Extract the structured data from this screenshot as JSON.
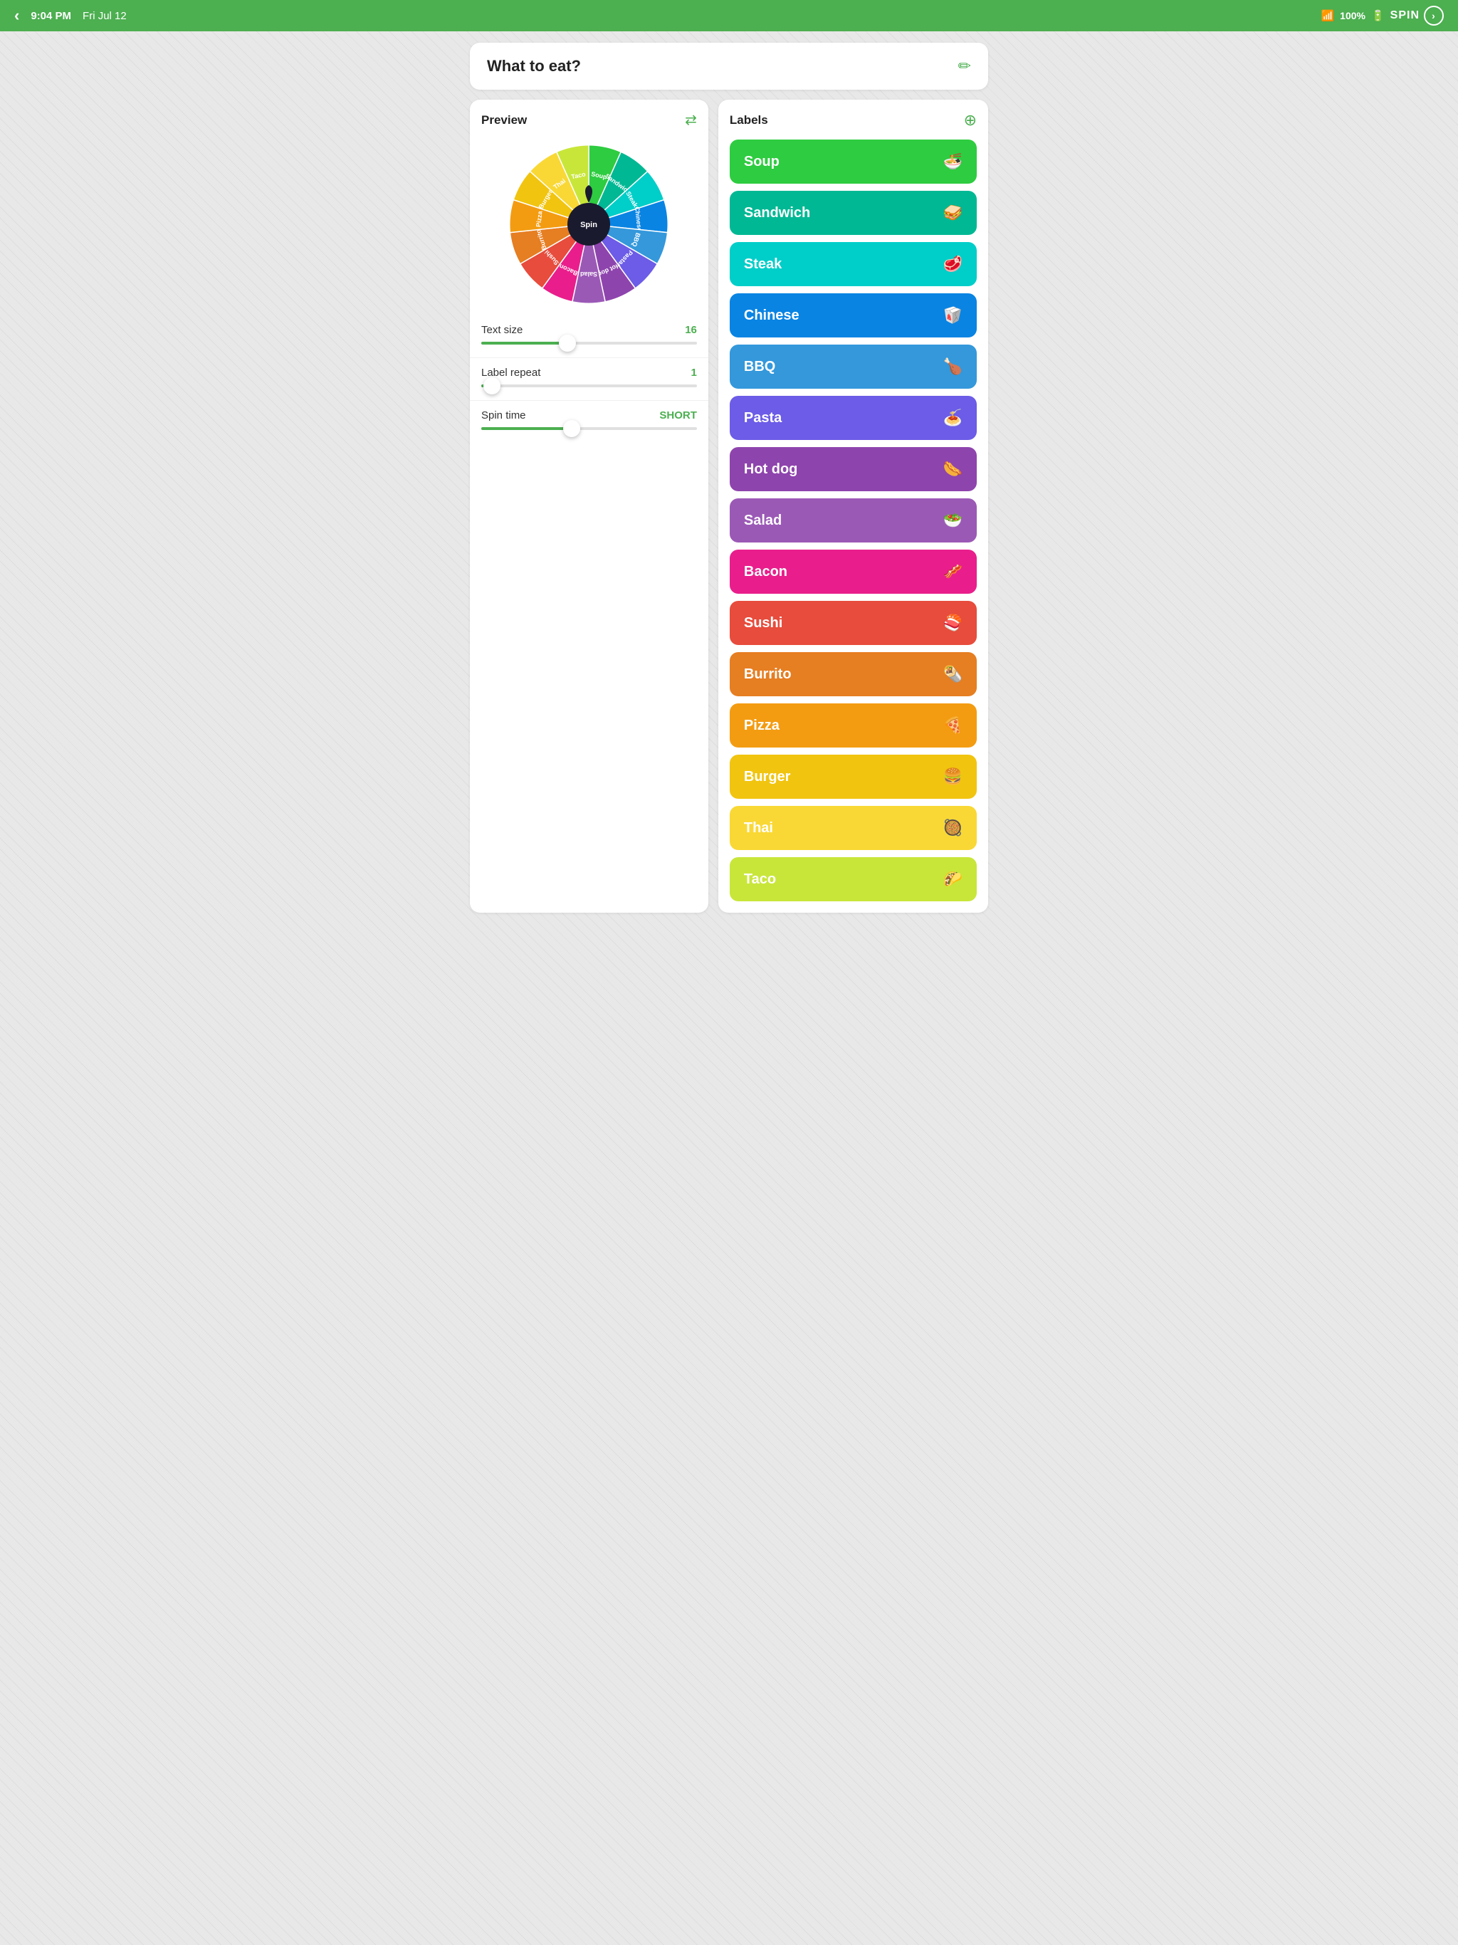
{
  "statusBar": {
    "time": "9:04 PM",
    "date": "Fri Jul 12",
    "battery": "100%",
    "backLabel": "‹",
    "spinLabel": "SPIN"
  },
  "titleCard": {
    "title": "What to eat?",
    "editIcon": "✏"
  },
  "leftPanel": {
    "previewLabel": "Preview",
    "shuffleIcon": "⇌",
    "spinButtonLabel": "Spin",
    "settings": [
      {
        "id": "text-size",
        "label": "Text size",
        "value": "16",
        "fillPercent": 40,
        "thumbPercent": 40
      },
      {
        "id": "label-repeat",
        "label": "Label repeat",
        "value": "1",
        "fillPercent": 5,
        "thumbPercent": 5
      },
      {
        "id": "spin-time",
        "label": "Spin time",
        "value": "SHORT",
        "fillPercent": 42,
        "thumbPercent": 42
      }
    ]
  },
  "rightPanel": {
    "labelsTitle": "Labels",
    "addIcon": "+",
    "items": [
      {
        "name": "Soup",
        "emoji": "🍜",
        "color": "#2ecc40"
      },
      {
        "name": "Sandwich",
        "emoji": "🥪",
        "color": "#00b894"
      },
      {
        "name": "Steak",
        "emoji": "🥩",
        "color": "#00cec9"
      },
      {
        "name": "Chinese",
        "emoji": "🥡",
        "color": "#0984e3"
      },
      {
        "name": "BBQ",
        "emoji": "🍗",
        "color": "#3498db"
      },
      {
        "name": "Pasta",
        "emoji": "🍝",
        "color": "#6c5ce7"
      },
      {
        "name": "Hot dog",
        "emoji": "🌭",
        "color": "#8e44ad"
      },
      {
        "name": "Salad",
        "emoji": "🥗",
        "color": "#9b59b6"
      },
      {
        "name": "Bacon",
        "emoji": "🥓",
        "color": "#e91e8c"
      },
      {
        "name": "Sushi",
        "emoji": "🍣",
        "color": "#e74c3c"
      },
      {
        "name": "Burrito",
        "emoji": "🌯",
        "color": "#e67e22"
      },
      {
        "name": "Pizza",
        "emoji": "🍕",
        "color": "#f39c12"
      },
      {
        "name": "Burger",
        "emoji": "🍔",
        "color": "#f1c40f"
      },
      {
        "name": "Thai",
        "emoji": "🥘",
        "color": "#f9d835"
      },
      {
        "name": "Taco",
        "emoji": "🌮",
        "color": "#c8e63a"
      }
    ]
  },
  "wheel": {
    "segments": [
      {
        "label": "Soup",
        "color": "#2ecc40",
        "emoji": "🍜"
      },
      {
        "label": "Sandwich",
        "color": "#00b894",
        "emoji": "🥪"
      },
      {
        "label": "Steak",
        "color": "#00cec9",
        "emoji": "🥩"
      },
      {
        "label": "Chinese",
        "color": "#0984e3",
        "emoji": "🥡"
      },
      {
        "label": "BBQ",
        "color": "#3498db",
        "emoji": "🍗"
      },
      {
        "label": "Pasta",
        "color": "#6c5ce7",
        "emoji": "🍝"
      },
      {
        "label": "Hot dog",
        "color": "#8e44ad",
        "emoji": "🌭"
      },
      {
        "label": "Salad",
        "color": "#9b59b6",
        "emoji": "🥗"
      },
      {
        "label": "Bacon",
        "color": "#e91e8c",
        "emoji": "🥓"
      },
      {
        "label": "Sushi",
        "color": "#e74c3c",
        "emoji": "🍣"
      },
      {
        "label": "Burrito",
        "color": "#e67e22",
        "emoji": "🌯"
      },
      {
        "label": "Pizza",
        "color": "#f39c12",
        "emoji": "🍕"
      },
      {
        "label": "Burger",
        "color": "#f1c40f",
        "emoji": "🍔"
      },
      {
        "label": "Thai",
        "color": "#f9d835",
        "emoji": "🥘"
      },
      {
        "label": "Taco",
        "color": "#c8e63a",
        "emoji": "🌮"
      }
    ]
  }
}
